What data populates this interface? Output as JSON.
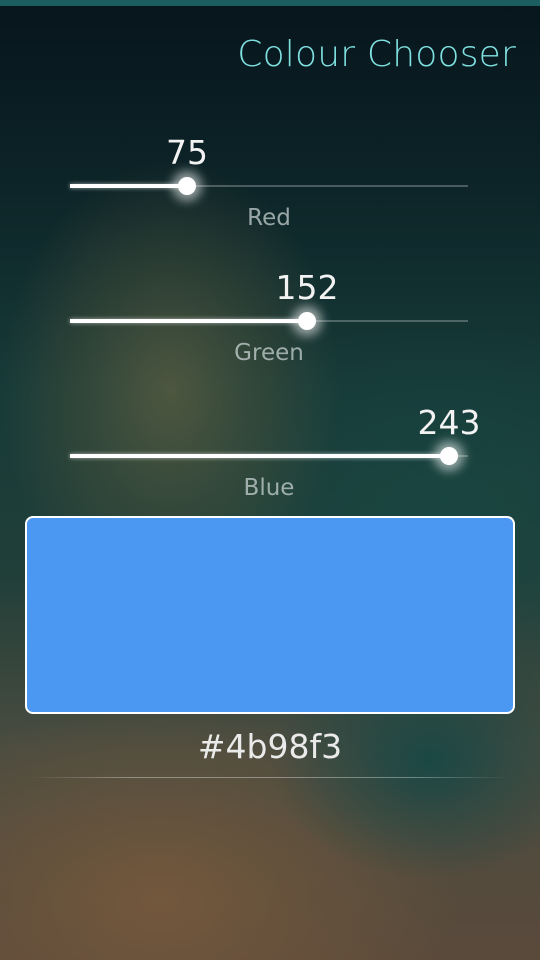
{
  "page": {
    "title": "Colour Chooser"
  },
  "sliders": [
    {
      "label": "Red",
      "value": "75",
      "fraction": 0.294
    },
    {
      "label": "Green",
      "value": "152",
      "fraction": 0.596
    },
    {
      "label": "Blue",
      "value": "243",
      "fraction": 0.953
    }
  ],
  "swatch": {
    "color": "#4b98f3"
  },
  "hex_value": "#4b98f3",
  "colors": {
    "title": "#7fe0e0",
    "swatch": "#4b98f3"
  }
}
